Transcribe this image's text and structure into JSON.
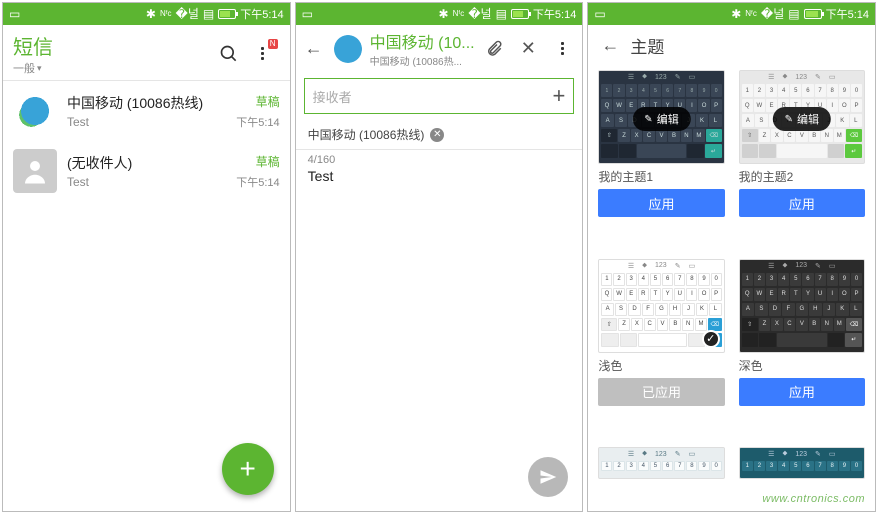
{
  "status_bar": {
    "time": "下午5:14",
    "nfc": "NFC",
    "bt_icon": "✱",
    "wifi_icon": "⇅",
    "battery_icon": "▮"
  },
  "screen1": {
    "title": "短信",
    "filter_label": "一般",
    "badge": "N",
    "messages": [
      {
        "name": "中国移动 (10086热线)",
        "preview": "Test",
        "status": "草稿",
        "time": "下午5:14",
        "avatar": "cm"
      },
      {
        "name": "(无收件人)",
        "preview": "Test",
        "status": "草稿",
        "time": "下午5:14",
        "avatar": "anon"
      }
    ]
  },
  "screen2": {
    "title": "中国移动 (10...",
    "subtitle": "中国移动 (10086热...",
    "recipient_placeholder": "接收者",
    "chip": "中国移动 (10086热线)",
    "counter": "4/160",
    "body": "Test"
  },
  "screen3": {
    "title": "主题",
    "edit_label": "编辑",
    "apply_label": "应用",
    "applied_label": "已应用",
    "themes": [
      {
        "name": "我的主题1",
        "scheme": "kb-dark1",
        "button": "apply",
        "editable": true
      },
      {
        "name": "我的主题2",
        "scheme": "kb-light1",
        "button": "apply",
        "editable": true
      },
      {
        "name": "浅色",
        "scheme": "kb-white",
        "button": "applied",
        "checked": true
      },
      {
        "name": "深色",
        "scheme": "kb-dark2",
        "button": "apply"
      },
      {
        "name": "",
        "scheme": "kb-teal",
        "button": "none",
        "partial": true
      },
      {
        "name": "",
        "scheme": "kb-teal2",
        "button": "none",
        "partial": true
      }
    ]
  },
  "watermark": "www.cntronics.com"
}
